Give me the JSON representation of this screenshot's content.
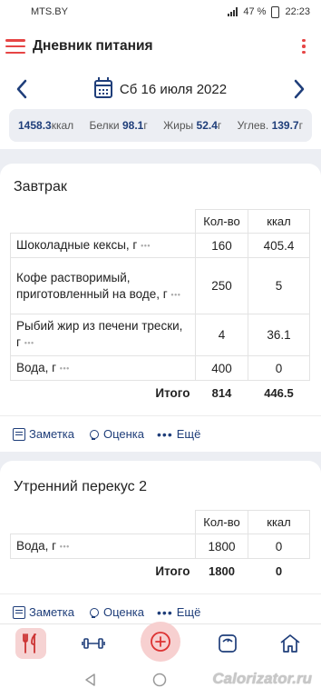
{
  "status": {
    "carrier": "MTS.BY",
    "battery": "47 %",
    "time": "22:23"
  },
  "appbar": {
    "title": "Дневник питания"
  },
  "date": {
    "label": "Сб 16 июля 2022"
  },
  "summary": {
    "kcal_value": "1458.3",
    "kcal_unit": "ккал",
    "protein_label": "Белки",
    "protein_value": "98.1",
    "protein_unit": "г",
    "fat_label": "Жиры",
    "fat_value": "52.4",
    "fat_unit": "г",
    "carb_label": "Углев.",
    "carb_value": "139.7",
    "carb_unit": "г"
  },
  "columns": {
    "qty": "Кол-во",
    "kcal": "ккал"
  },
  "more_glyph": "•••",
  "meals": [
    {
      "title": "Завтрак",
      "rows": [
        {
          "name": "Шоколадные кексы, г",
          "qty": "160",
          "kcal": "405.4"
        },
        {
          "name": "Кофе растворимый, приготовленный на воде, г",
          "qty": "250",
          "kcal": "5"
        },
        {
          "name": "Рыбий жир из печени трески, г",
          "qty": "4",
          "kcal": "36.1"
        },
        {
          "name": "Вода, г",
          "qty": "400",
          "kcal": "0"
        }
      ],
      "total_label": "Итого",
      "total_qty": "814",
      "total_kcal": "446.5"
    },
    {
      "title": "Утренний перекус 2",
      "rows": [
        {
          "name": "Вода, г",
          "qty": "1800",
          "kcal": "0"
        }
      ],
      "total_label": "Итого",
      "total_qty": "1800",
      "total_kcal": "0"
    }
  ],
  "actions": {
    "note": "Заметка",
    "rating": "Оценка",
    "more": "Ещё",
    "more_glyph": "•••"
  },
  "watermark": "Calorizator.ru",
  "colors": {
    "accent_red": "#e64545",
    "accent_blue": "#1f3e7a"
  }
}
